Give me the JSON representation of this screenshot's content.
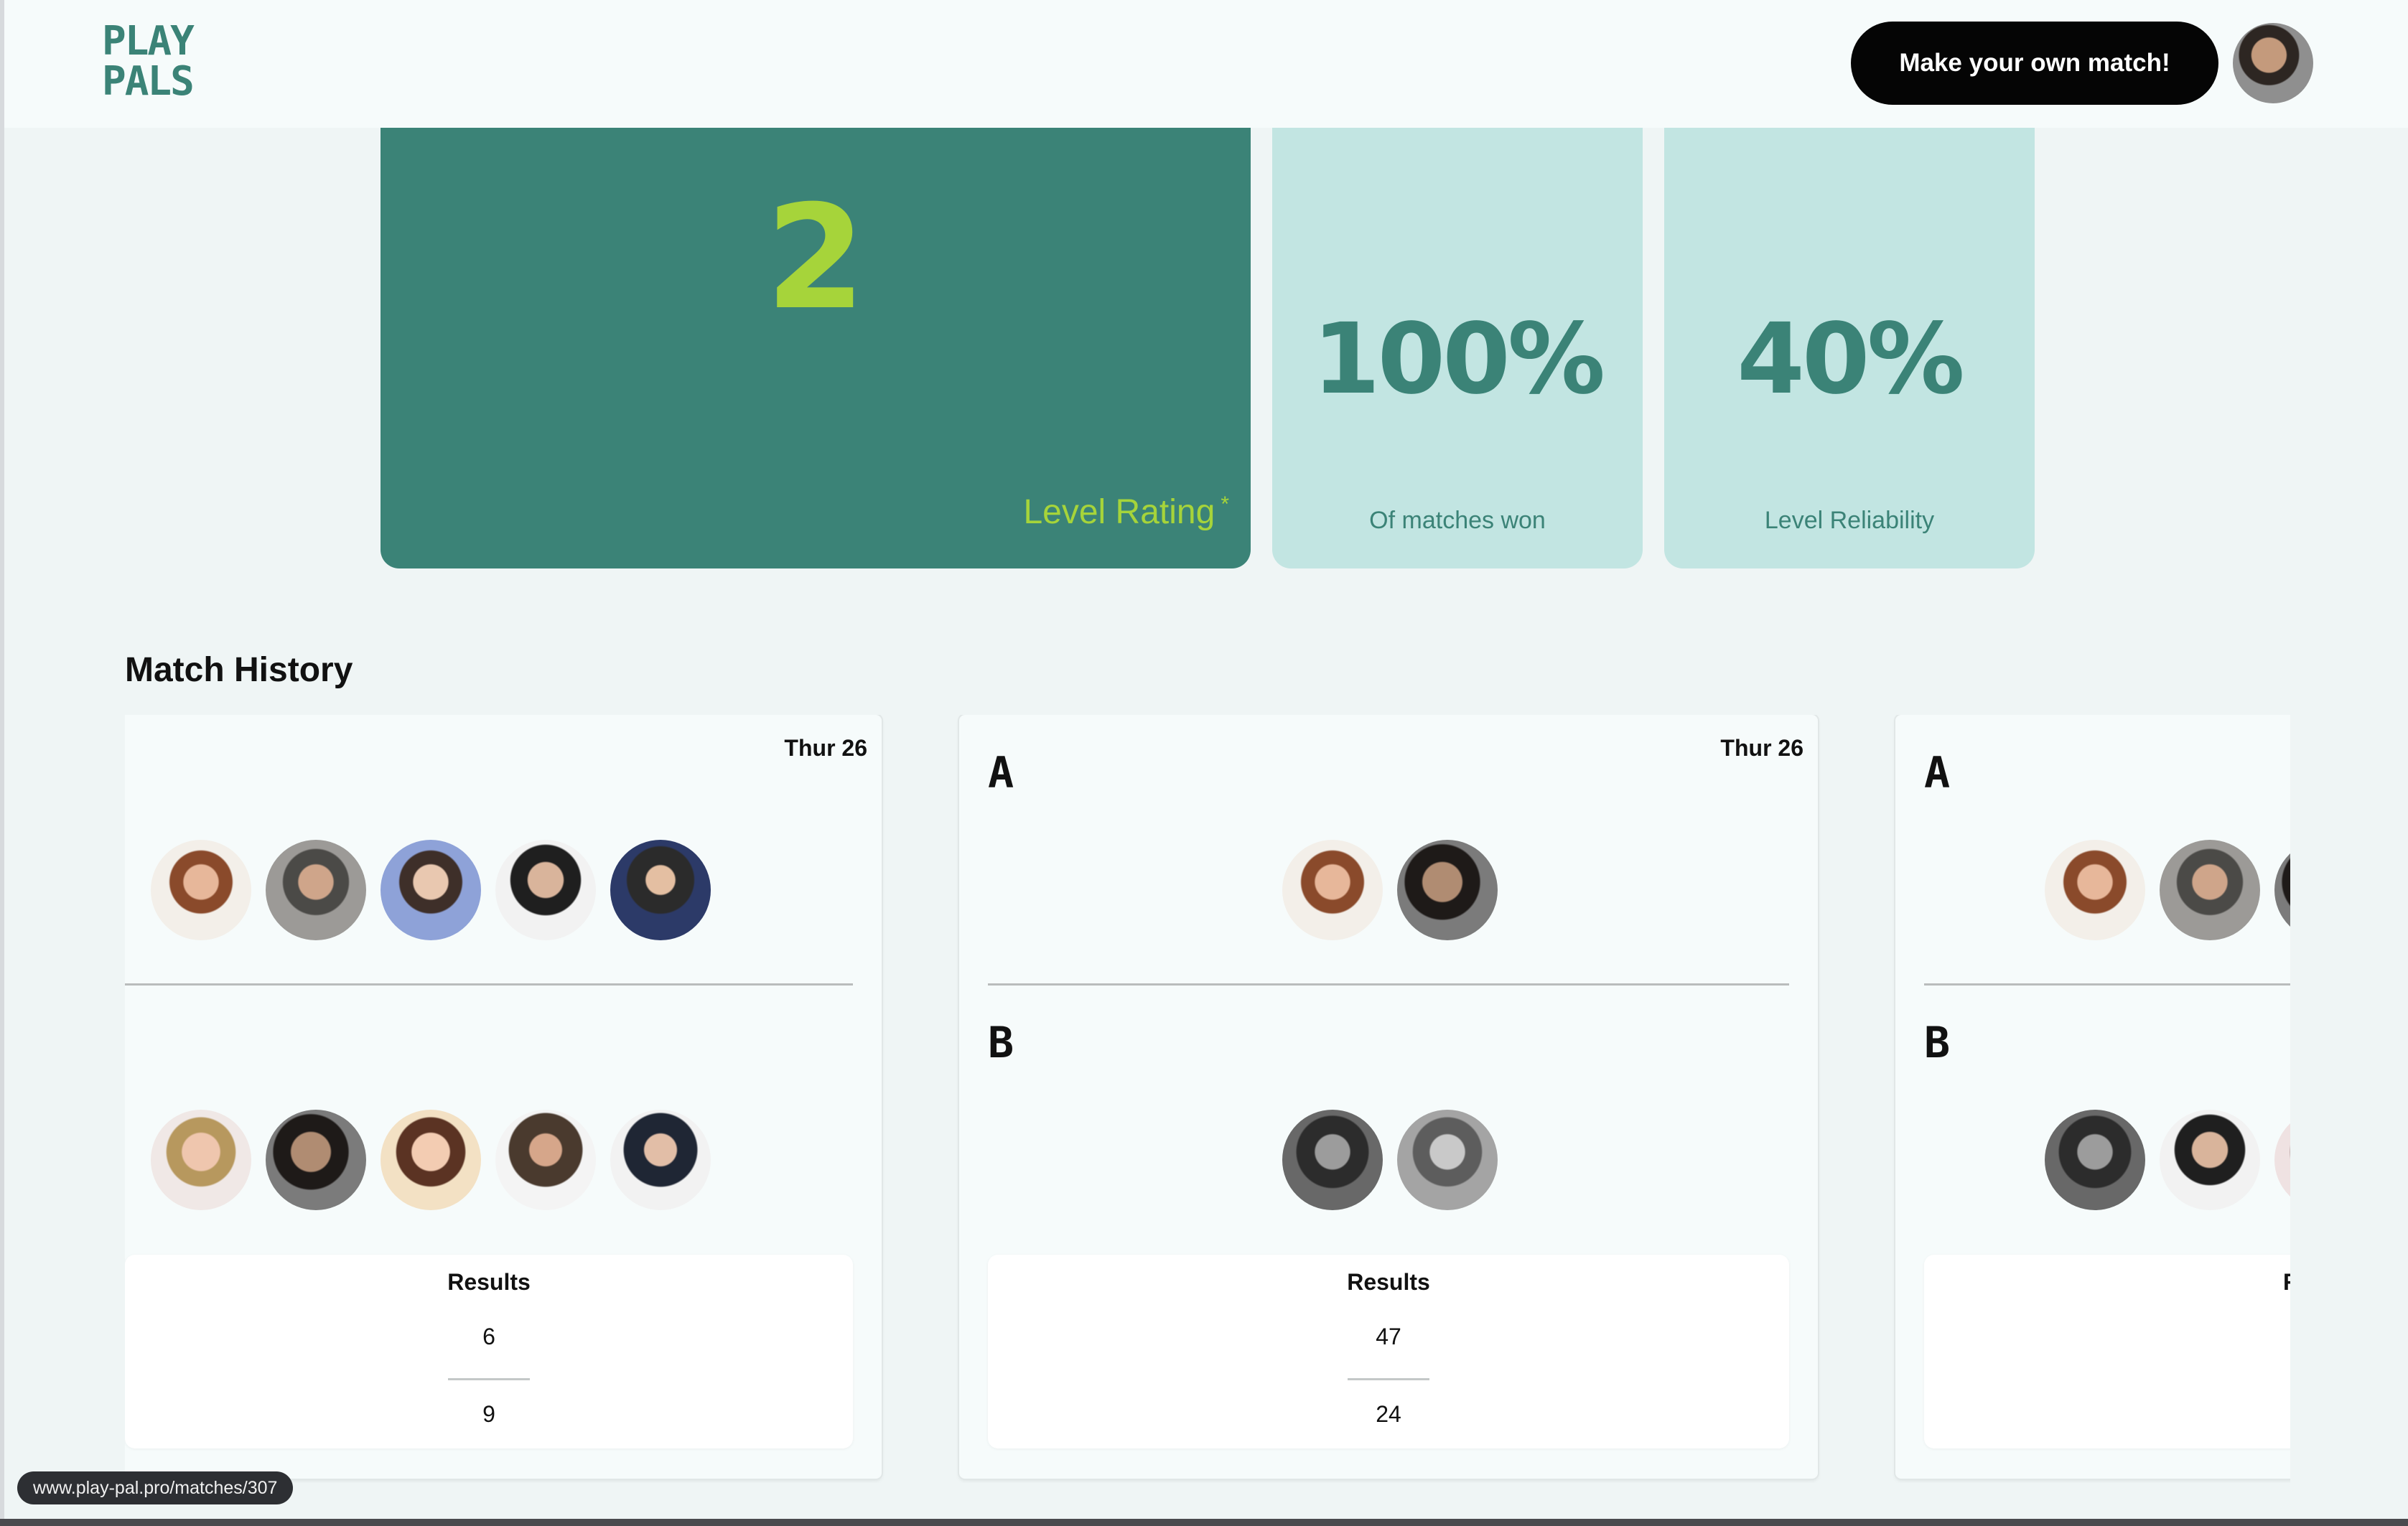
{
  "header": {
    "logo": {
      "line1": "PLAY",
      "line2": "PALS"
    },
    "cta_label": "Make your own match!"
  },
  "stats": {
    "level": {
      "value": "2",
      "label": "Level Rating",
      "marker": "*"
    },
    "matches_won": {
      "value": "100%",
      "label": "Of matches won"
    },
    "reliability": {
      "value": "40%",
      "label": "Level Reliability"
    }
  },
  "match_history": {
    "title": "Match History",
    "cards": [
      {
        "date": "Thur 26",
        "team_a": "",
        "team_b": "",
        "results_title": "Results",
        "score_a": "6",
        "score_b": "9"
      },
      {
        "date": "Thur 26",
        "team_a": "A",
        "team_b": "B",
        "results_title": "Results",
        "score_a": "47",
        "score_b": "24"
      },
      {
        "date": "",
        "team_a": "A",
        "team_b": "B",
        "results_title": "R",
        "score_a": "",
        "score_b": ""
      }
    ]
  },
  "status_bar": {
    "url": "www.play-pal.pro/matches/307"
  },
  "colors": {
    "brand_green": "#3b8377",
    "accent_lime": "#a6d43a",
    "light_teal": "#c2e5e2",
    "cta_black": "#050505"
  }
}
